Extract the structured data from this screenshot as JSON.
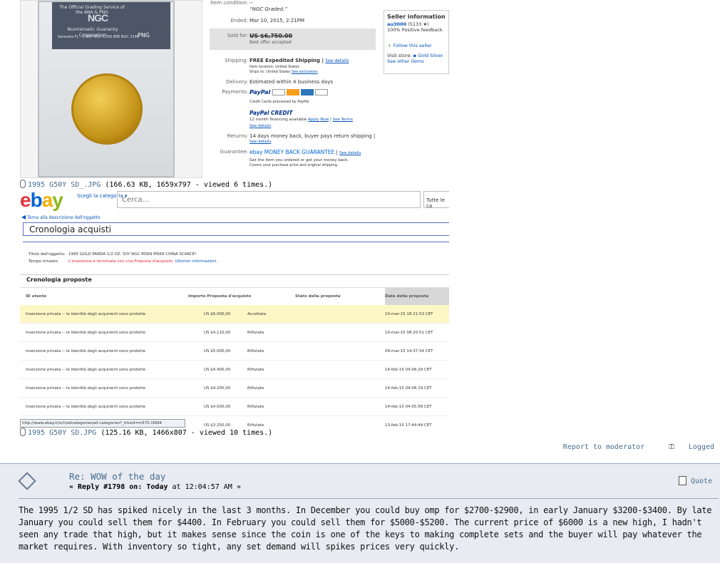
{
  "photo": {
    "label_top": "The Official Grading Service of the ANA & PNG",
    "label_logo": "NGC",
    "label_corp": "Numismatic Guaranty Corporation",
    "label_small": "Sarasota FL · 1-800-NGC-COIN",
    "label_cert": "888 NGC 2148",
    "label_png": "PNG"
  },
  "attachment1": {
    "name": "1995 G50Y SD_.JPG",
    "info": "(166.63 KB, 1659x797 - viewed 6 times.)"
  },
  "attachment2": {
    "name": "1995 G50Y SD.JPG",
    "info": "(125.16 KB, 1466x807 - viewed 10 times.)"
  },
  "listing": {
    "condition_label": "Item condition:",
    "condition_value": "--",
    "condition_note": "“NGC Graded.”",
    "ended_label": "Ended:",
    "ended_value": "Mar 10, 2015, 2:21PM",
    "sold_label": "Sold for:",
    "sold_value": "US $6,750.00",
    "sold_note": "Best offer accepted",
    "shipping_label": "Shipping:",
    "shipping_value": "FREE Expedited Shipping |",
    "shipping_link": "See details",
    "shipping_loc": "Item location: United States",
    "shipping_to": "Ships to: United States",
    "shipping_excl": "See exclusions",
    "delivery_label": "Delivery:",
    "delivery_value": "Estimated within 4 business days",
    "payments_label": "Payments:",
    "paypal": "PayPal",
    "cards_note": "Credit Cards processed by PayPal",
    "paypal_credit": "PayPal CREDIT",
    "financing": "12 month financing available",
    "apply_now": "Apply Now",
    "see_terms": "See Terms",
    "see_details2": "See details",
    "returns_label": "Returns:",
    "returns_value": "14 days money back, buyer pays return shipping |",
    "returns_link": "See details",
    "guarantee_label": "Guarantee:",
    "guarantee_value": "ebay MONEY BACK GUARANTEE",
    "guarantee_link": "See details",
    "guarantee_note1": "Get the item you ordered or get your money back.",
    "guarantee_note2": "Covers your purchase price and original shipping."
  },
  "seller": {
    "title": "Seller information",
    "name": "au3000",
    "score": "(5133 ★)",
    "positive": "100% Positive feedback",
    "follow": "Follow this seller",
    "visit": "Visit store:",
    "store": "Gold Silver",
    "other": "See other items"
  },
  "ebay": {
    "cat_label": "Scegli la categoria",
    "search_placeholder": "Cerca...",
    "all_categories": "Tutte le ca",
    "back_link": "Torna alla descrizione dell'oggetto",
    "page_title": "Cronologia acquisti",
    "item_title_label": "Titolo dell'oggetto:",
    "item_title_value": "1995 GOLD PANDA 1/2 OZ. 50Y NGC MS69 MS69 CHINA SCARCE!",
    "time_label": "Tempo rimasto:",
    "time_value": "L'inserzione è terminata con una Proposta d'acquisto.",
    "more_info": "Ulteriori informazioni.",
    "section": "Cronologia proposte",
    "columns": [
      "ID utente",
      "Importo Proposta d'acquisto",
      "Stato della proposta",
      "Data della proposta"
    ],
    "rows": [
      {
        "user": "Inserzione privata -- le identità degli acquirenti sono protette",
        "amount": "US $6.000,00",
        "status": "Accettata",
        "date": "10-mar-15 18:21:53 CET"
      },
      {
        "user": "Inserzione privata -- le identità degli acquirenti sono protette",
        "amount": "US $4.110,00",
        "status": "Rifiutate",
        "date": "10-mar-15 08:20:51 CET"
      },
      {
        "user": "Inserzione privata -- le identità degli acquirenti sono protette",
        "amount": "US $5.000,00",
        "status": "Rifiutate",
        "date": "09-mar-15 14:37:34 CET"
      },
      {
        "user": "Inserzione privata -- le identità degli acquirenti sono protette",
        "amount": "US $4.400,00",
        "status": "Rifiutate",
        "date": "14-feb-15 04:06:29 CET"
      },
      {
        "user": "Inserzione privata -- le identità degli acquirenti sono protette",
        "amount": "US $4.200,00",
        "status": "Rifiutate",
        "date": "14-feb-15 04:06:19 CET"
      },
      {
        "user": "Inserzione privata -- le identità degli acquirenti sono protette",
        "amount": "US $4.000,00",
        "status": "Rifiutate",
        "date": "14-feb-15 04:05:58 CET"
      },
      {
        "user": "",
        "amount": "US $3.250,00",
        "status": "Rifiutate",
        "date": "13-feb-15 17:44:44 CET"
      }
    ],
    "status_url": "http://www.ebay.it/sch/allcategories/all-categories?_trksid=m570.l3694"
  },
  "forum": {
    "report": "Report to moderator",
    "logged": "Logged",
    "post_title": "Re: WOW of the day",
    "reply_label": "« Reply #1798 on:",
    "reply_when": "Today",
    "reply_time": "at 12:04:57 AM »",
    "quote": "Quote",
    "body": "The 1995 1/2 SD has spiked nicely in the last 3 months.  In December you could buy omp for $2700-$2900, in early January $3200-$3400.  By late January you could sell them for $4400.  In February you could sell them for $5000-$5200.  The current price of $6000 is a new high, I hadn't seen any trade that high, but it makes sense since the coin is one of the keys to making complete sets and the buyer will pay whatever the market requires. With inventory so tight, any set demand will spikes prices very quickly."
  },
  "colors": {
    "link": "#476c8e",
    "ebay_blue": "#0654ba",
    "post_bg": "#e8ebf1"
  }
}
